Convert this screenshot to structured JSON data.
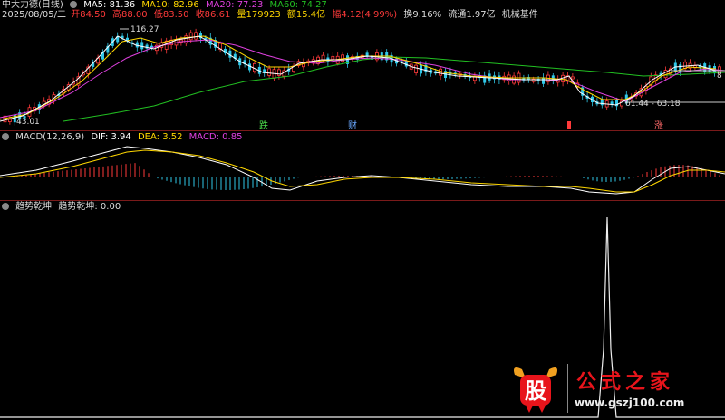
{
  "header": {
    "title": "中大力德(日线)",
    "ma5": "MA5: 81.36",
    "ma10": "MA10: 82.96",
    "ma20": "MA20: 77.23",
    "ma60": "MA60: 74.27",
    "date": "2025/08/05/二",
    "open": "开84.50",
    "high": "高88.00",
    "low": "低83.50",
    "close": "收86.61",
    "volume": "量179923",
    "amount": "额15.4亿",
    "change": "幅4.12(4.99%)",
    "turnover": "换9.16%",
    "float": "流通1.97亿",
    "sector": "机械基件"
  },
  "price_panel": {
    "high_label": "116.27",
    "low_label": "43.01",
    "range_label": "61.44 - 63.18",
    "right_label": "8",
    "markers": [
      "跌",
      "财",
      "",
      "涨"
    ],
    "colors": {
      "ma5": "#ffffff",
      "ma10": "#ffd700",
      "ma20": "#e040e0",
      "ma60": "#22c022",
      "up": "#ff3a3a",
      "down": "#30c8e8"
    }
  },
  "macd_panel": {
    "label": "MACD(12,26,9)",
    "dif": "DIF: 3.94",
    "dea": "DEA: 3.52",
    "macd": "MACD: 0.85"
  },
  "indicator_panel": {
    "name": "趋势乾坤",
    "value_label": "趋势乾坤: 0.00"
  },
  "watermark": {
    "logo_char": "股",
    "title": "公式之家",
    "url": "www.gszj100.com"
  }
}
